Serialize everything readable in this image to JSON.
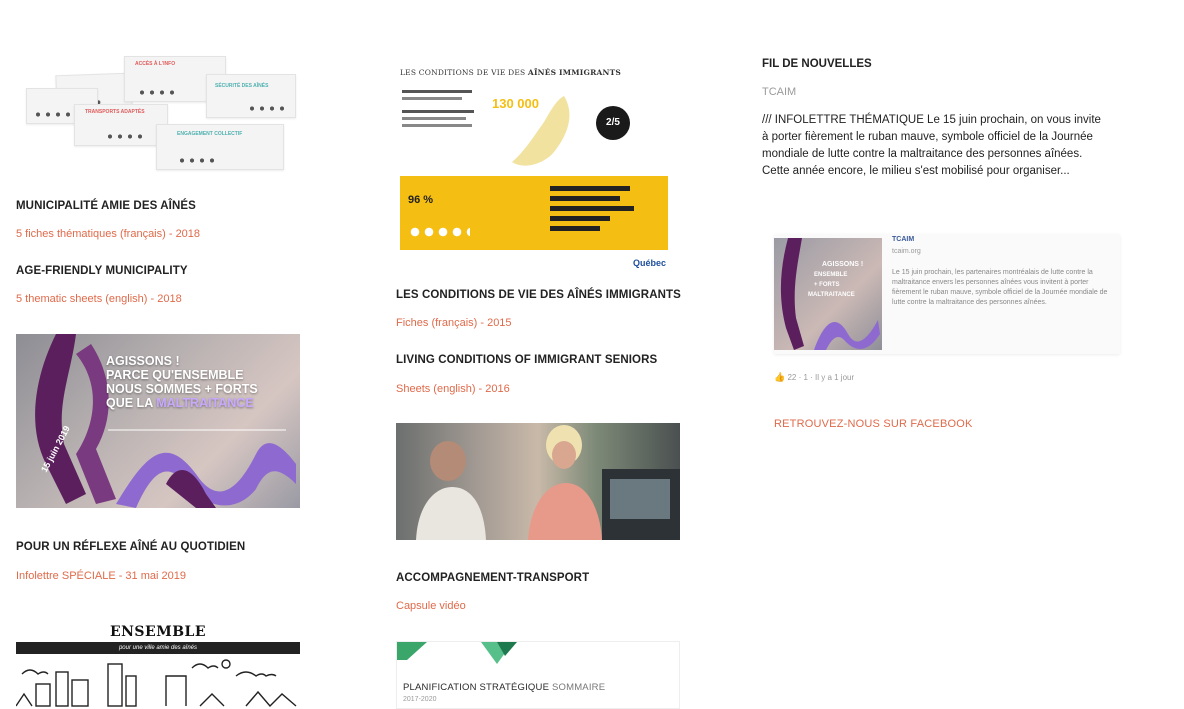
{
  "col1": {
    "item1": {
      "heading": "MUNICIPALITÉ AMIE DES AÎNÉS",
      "link": "5 fiches thématiques (français) - 2018"
    },
    "item2": {
      "heading": "AGE-FRIENDLY MUNICIPALITY",
      "link": "5 thematic sheets (english) - 2018"
    },
    "ribbon": {
      "line1": "AGISSONS !",
      "line2": "PARCE QU'ENSEMBLE",
      "line3": "NOUS SOMMES + FORTS",
      "line4a": "QUE LA ",
      "line4b": "MALTRAITANCE",
      "date": "15 juin 2019"
    },
    "item3": {
      "heading": "POUR UN RÉFLEXE AÎNÉ AU QUOTIDIEN",
      "link": "Infolettre SPÉCIALE - 31 mai 2019"
    },
    "ensemble": {
      "title": "ENSEMBLE",
      "subtitle": "pour une ville amie des aînés"
    }
  },
  "col2": {
    "cond": {
      "title_prefix": "LES CONDITIONS DE VIE DES ",
      "title_bold": "AÎNÉS IMMIGRANTS",
      "stat1": "130 000",
      "stat2": "2/5",
      "stat3": "96 %",
      "logo": "Québec"
    },
    "item1": {
      "heading": "LES CONDITIONS DE VIE DES AÎNÉS IMMIGRANTS",
      "link": "Fiches (français) - 2015"
    },
    "item2": {
      "heading": "LIVING CONDITIONS OF IMMIGRANT SENIORS",
      "link": "Sheets (english) - 2016"
    },
    "item3": {
      "heading": "ACCOMPAGNEMENT-TRANSPORT",
      "link": "Capsule vidéo"
    },
    "plan": {
      "title": "PLANIFICATION STRATÉGIQUE ",
      "title_light": "SOMMAIRE",
      "years": "2017-2020"
    }
  },
  "col3": {
    "feed_title": "FIL DE NOUVELLES",
    "feed_source": "TCAIM",
    "feed_body": "/// INFOLETTRE THÉMATIQUE Le 15 juin prochain, on vous invite à porter fièrement le ruban mauve, symbole officiel de la Journée mondiale de lutte contre la maltraitance des personnes aînées. Cette année encore, le milieu s'est mobilisé pour organiser...",
    "fb": {
      "name": "TCAIM",
      "url": "tcaim.org",
      "text": "Le 15 juin prochain, les partenaires montréalais de lutte contre la maltraitance envers les personnes aînées vous invitent à porter fièrement le ruban mauve, symbole officiel de la Journée mondiale de lutte contre la maltraitance des personnes aînées.",
      "meta": "22 · 1 · Il y a 1 jour"
    },
    "fb_link": "RETROUVEZ-NOUS SUR FACEBOOK"
  },
  "colors": {
    "link": "#e06a4a",
    "ribbon_purple": "#5b1f5e",
    "ribbon_lilac": "#8e6ad0",
    "yellow": "#f5be12"
  }
}
